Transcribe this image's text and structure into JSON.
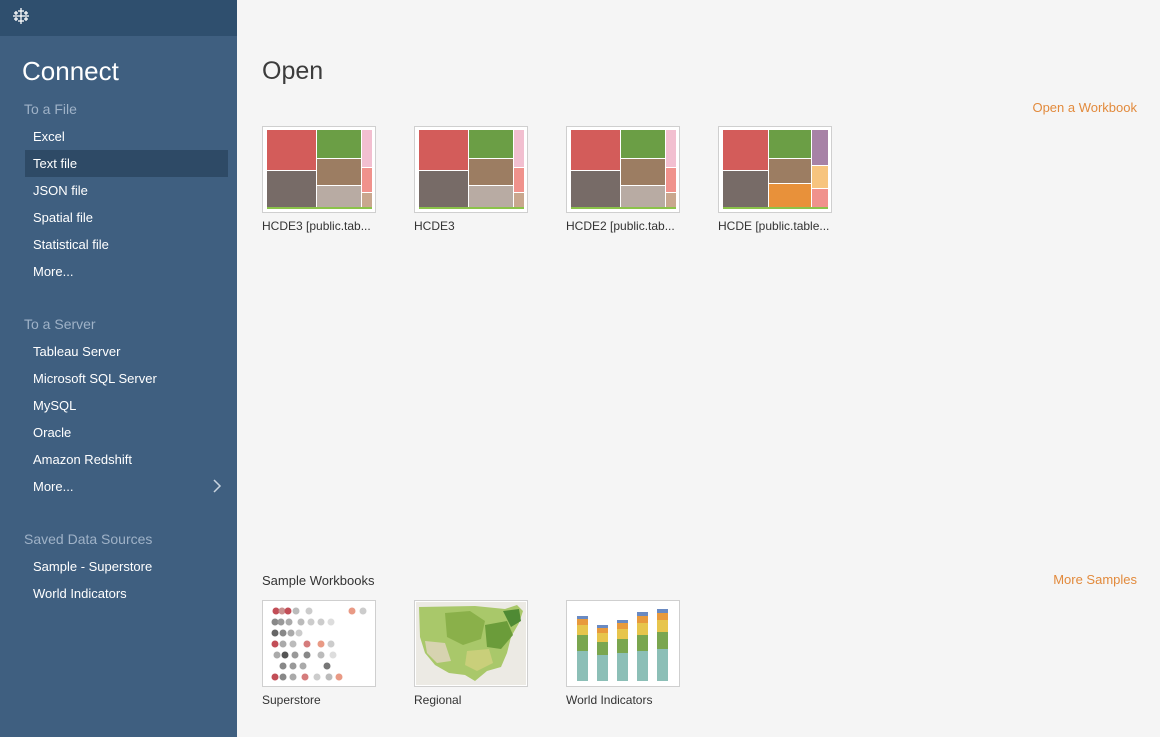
{
  "sidebar": {
    "title": "Connect",
    "to_file": {
      "heading": "To a File",
      "items": [
        "Excel",
        "Text file",
        "JSON file",
        "Spatial file",
        "Statistical file",
        "More..."
      ]
    },
    "to_server": {
      "heading": "To a Server",
      "items": [
        "Tableau Server",
        "Microsoft SQL Server",
        "MySQL",
        "Oracle",
        "Amazon Redshift",
        "More..."
      ]
    },
    "saved": {
      "heading": "Saved Data Sources",
      "items": [
        "Sample - Superstore",
        "World Indicators"
      ]
    }
  },
  "main": {
    "title": "Open",
    "open_workbook": "Open a Workbook",
    "recent": [
      {
        "label": "HCDE3 [public.tab..."
      },
      {
        "label": "HCDE3"
      },
      {
        "label": "HCDE2 [public.tab..."
      },
      {
        "label": "HCDE [public.table..."
      }
    ],
    "samples_heading": "Sample Workbooks",
    "more_samples": "More Samples",
    "samples": [
      {
        "label": "Superstore"
      },
      {
        "label": "Regional"
      },
      {
        "label": "World Indicators"
      }
    ]
  },
  "colors": {
    "sidebar": "#3f5f80",
    "sidebar_top": "#2f4f6e",
    "accent": "#e28a3c",
    "treemap_red": "#d35c5a",
    "treemap_green": "#6b9e45",
    "treemap_gray": "#776b67",
    "treemap_brown": "#9c7d62",
    "treemap_tan": "#b8aba3",
    "treemap_pink": "#f2bfd0",
    "treemap_salmon": "#f0928c"
  }
}
